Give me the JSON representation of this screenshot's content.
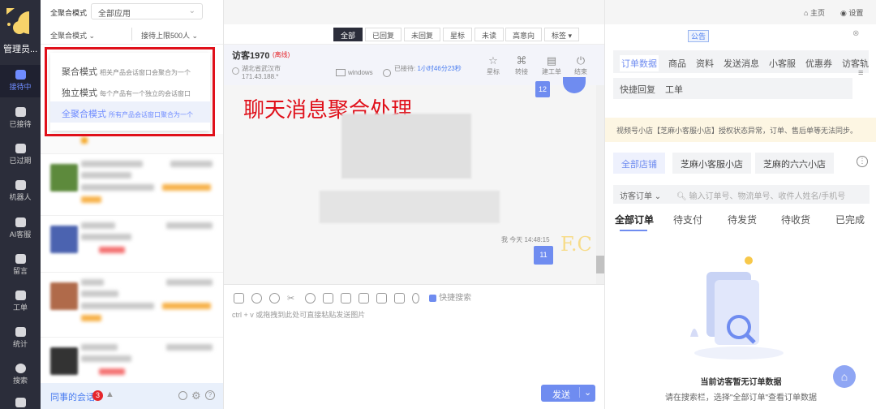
{
  "sidebar": {
    "admin": "管理员...",
    "items": [
      {
        "label": "接待中"
      },
      {
        "label": "已接待"
      },
      {
        "label": "已过期"
      },
      {
        "label": "机器人"
      },
      {
        "label": "AI客服"
      },
      {
        "label": "留言"
      },
      {
        "label": "工单"
      },
      {
        "label": "统计"
      },
      {
        "label": "搜索"
      }
    ]
  },
  "left": {
    "mode_label": "全聚合模式",
    "app_select": "全部应用",
    "mode_select": "全聚合模式",
    "limit_select": "接待上限500人",
    "modes": [
      {
        "name": "聚合模式",
        "desc": "相关产品会话窗口会聚合为一个"
      },
      {
        "name": "独立模式",
        "desc": "每个产品有一个独立的会话窗口"
      },
      {
        "name": "全聚合模式",
        "desc": "所有产品会话窗口聚合为一个"
      }
    ],
    "footer": {
      "label": "同事的会话",
      "badge": "3"
    }
  },
  "filters": [
    "全部",
    "已回复",
    "未回复",
    "星标",
    "未读",
    "高意向",
    "标签 ▾"
  ],
  "chat": {
    "visitor": "访客1970",
    "status": "(离线)",
    "location": "湖北省武汉市",
    "ip": "171.43.188.*",
    "os": "windows",
    "served_label": "已接待:",
    "served_time": "1小时46分23秒",
    "actions": [
      "星标",
      "转接",
      "建工单",
      "结束"
    ],
    "annotation": "聊天消息聚合处理",
    "msg_top": "12",
    "msg_meta": "我  今天 14:48:15",
    "msg": "11",
    "quick_search": "快捷搜索",
    "input_placeholder": "ctrl + v 或拖拽到此处可直接粘贴发送图片",
    "send": "发送"
  },
  "topright": {
    "home": "主页",
    "settings": "设置",
    "notice": "公告"
  },
  "right": {
    "tabs": [
      "订单数据",
      "商品",
      "资料",
      "发送消息",
      "小客服",
      "优惠券",
      "访客轨迹"
    ],
    "tabs2": [
      "快捷回复",
      "工单"
    ],
    "banner": "视频号小店【芝麻小客服小店】授权状态异常，订单、售后单等无法同步。",
    "shops": [
      "全部店铺",
      "芝麻小客服小店",
      "芝麻的六六小店"
    ],
    "order_select": "访客订单",
    "search_placeholder": "输入订单号、物流单号、收件人姓名/手机号",
    "order_tabs": [
      "全部订单",
      "待支付",
      "待发货",
      "待收货",
      "已完成"
    ],
    "empty_title": "当前访客暂无订单数据",
    "empty_hint": "请在搜索栏，选择\"全部订单\"查看订单数据"
  },
  "colors": {
    "accent": "#6f8cf0",
    "sidebar": "#2b2d3a",
    "annotation": "#e0101a"
  }
}
